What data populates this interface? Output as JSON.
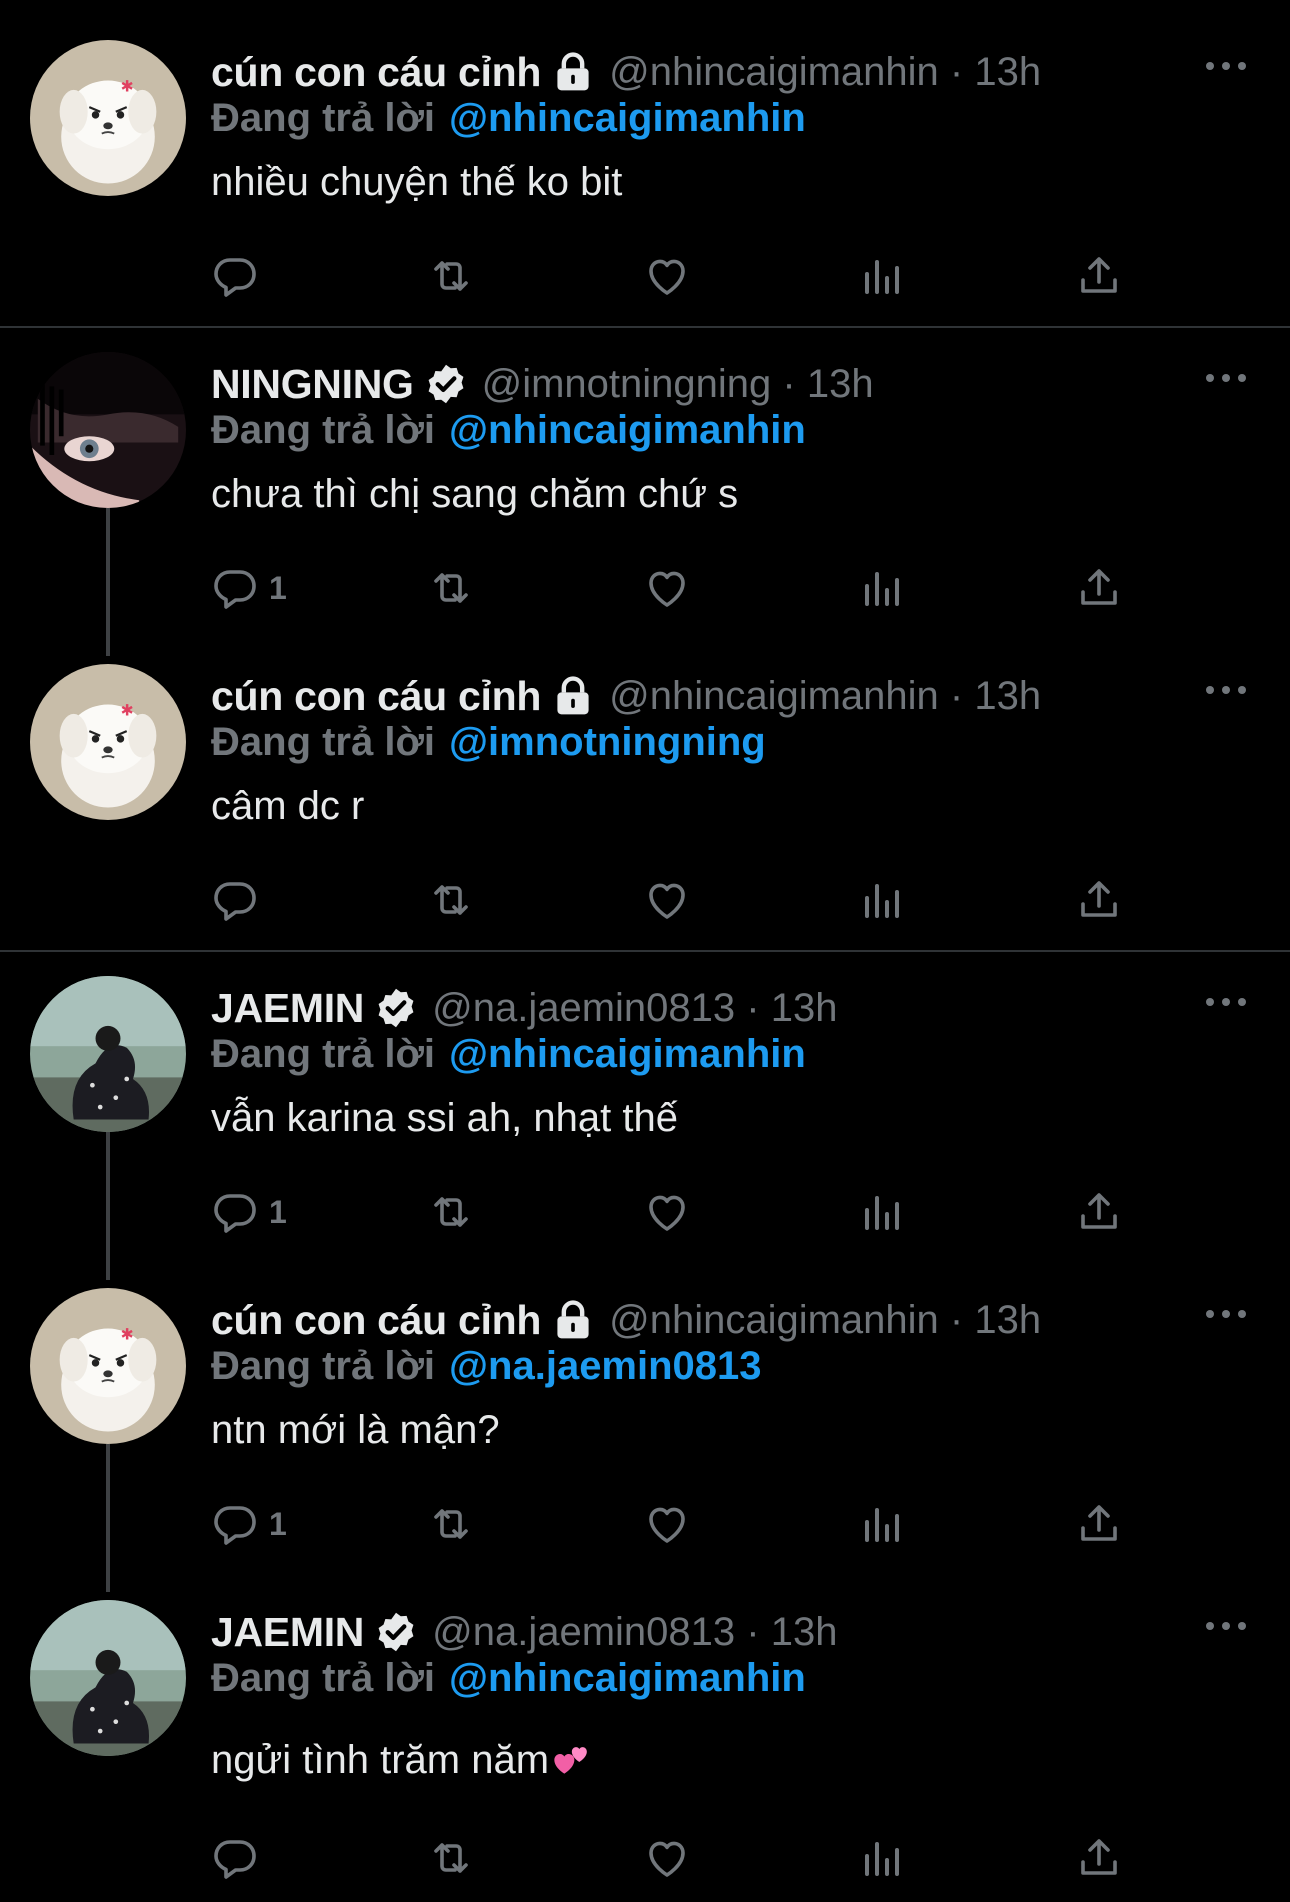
{
  "colors": {
    "background": "#000000",
    "name": "#e7e9ea",
    "muted": "#71767b",
    "accent": "#1d9bf0"
  },
  "reply_label": "Đang trả lời",
  "tweets": [
    {
      "name": "cún con cáu cỉnh",
      "badge": "lock-icon",
      "handle": "@nhincaigimanhin · 13h",
      "reply_to": "@nhincaigimanhin",
      "text": "nhiều chuyện thế ko bit",
      "reply_count": ""
    },
    {
      "name": "NINGNING",
      "badge": "verified-icon",
      "handle": "@imnotningning · 13h",
      "reply_to": "@nhincaigimanhin",
      "text": "chưa thì chị sang chăm chứ s",
      "reply_count": "1"
    },
    {
      "name": "cún con cáu cỉnh",
      "badge": "lock-icon",
      "handle": "@nhincaigimanhin · 13h",
      "reply_to": "@imnotningning",
      "text": "câm dc r",
      "reply_count": ""
    },
    {
      "name": "JAEMIN",
      "badge": "verified-icon",
      "handle": "@na.jaemin0813 · 13h",
      "reply_to": "@nhincaigimanhin",
      "text": "vẫn karina ssi ah, nhạt thế",
      "reply_count": "1"
    },
    {
      "name": "cún con cáu cỉnh",
      "badge": "lock-icon",
      "handle": "@nhincaigimanhin · 13h",
      "reply_to": "@na.jaemin0813",
      "text": "ntn mới là mận?",
      "reply_count": "1"
    },
    {
      "name": "JAEMIN",
      "badge": "verified-icon",
      "handle": "@na.jaemin0813 · 13h",
      "reply_to": "@nhincaigimanhin",
      "text": "ngửi tình trăm năm",
      "reply_count": ""
    }
  ]
}
